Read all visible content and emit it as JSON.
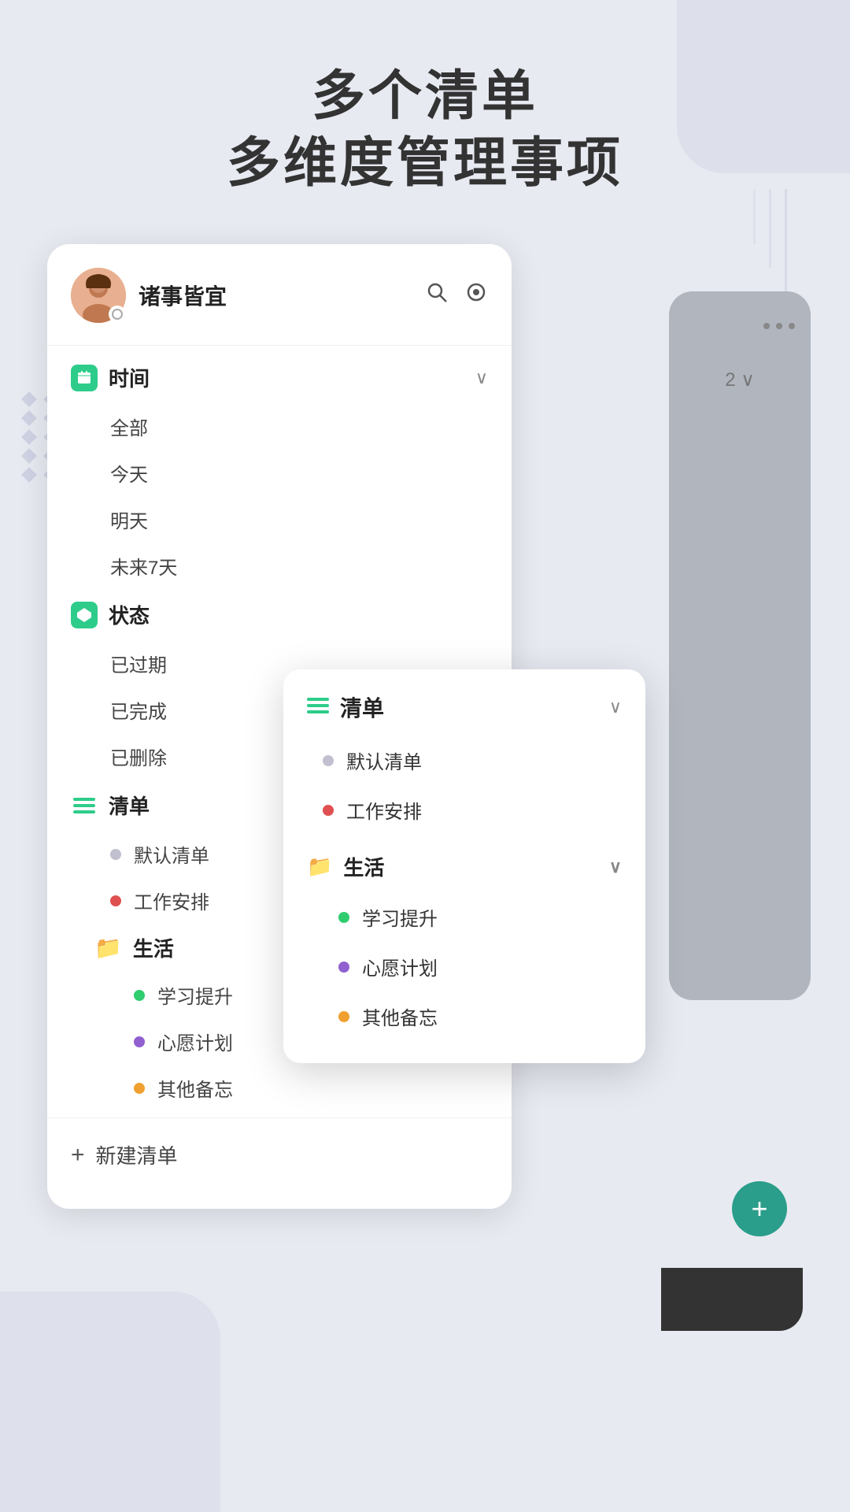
{
  "page": {
    "title_line1": "多个清单",
    "title_line2": "多维度管理事项"
  },
  "sidebar": {
    "username": "诸事皆宜",
    "search_icon": "🔍",
    "settings_icon": "⊙",
    "sections": [
      {
        "id": "time",
        "label": "时间",
        "icon_type": "green",
        "expanded": true,
        "items": [
          "全部",
          "今天",
          "明天",
          "未来7天"
        ]
      },
      {
        "id": "status",
        "label": "状态",
        "icon_type": "teal",
        "expanded": true,
        "items": [
          "已过期",
          "已完成",
          "已删除"
        ]
      }
    ],
    "lists_section": {
      "label": "清单",
      "items": [
        {
          "label": "默认清单",
          "dot_color": "gray"
        },
        {
          "label": "工作安排",
          "dot_color": "red"
        }
      ],
      "folders": [
        {
          "label": "生活",
          "color": "orange",
          "items": [
            {
              "label": "学习提升",
              "dot_color": "green"
            },
            {
              "label": "心愿计划",
              "dot_color": "purple"
            },
            {
              "label": "其他备忘",
              "dot_color": "orange"
            }
          ]
        }
      ]
    },
    "new_list_label": "新建清单"
  },
  "popup": {
    "section_label": "清单",
    "items": [
      {
        "label": "默认清单",
        "dot_color": "gray"
      },
      {
        "label": "工作安排",
        "dot_color": "red"
      }
    ],
    "folder": {
      "label": "生活",
      "items": [
        {
          "label": "学习提升",
          "dot_color": "green"
        },
        {
          "label": "心愿计划",
          "dot_color": "purple"
        },
        {
          "label": "其他备忘",
          "dot_color": "orange"
        }
      ]
    }
  },
  "bg_phone": {
    "num_badge": "2",
    "fab_icon": "+"
  }
}
